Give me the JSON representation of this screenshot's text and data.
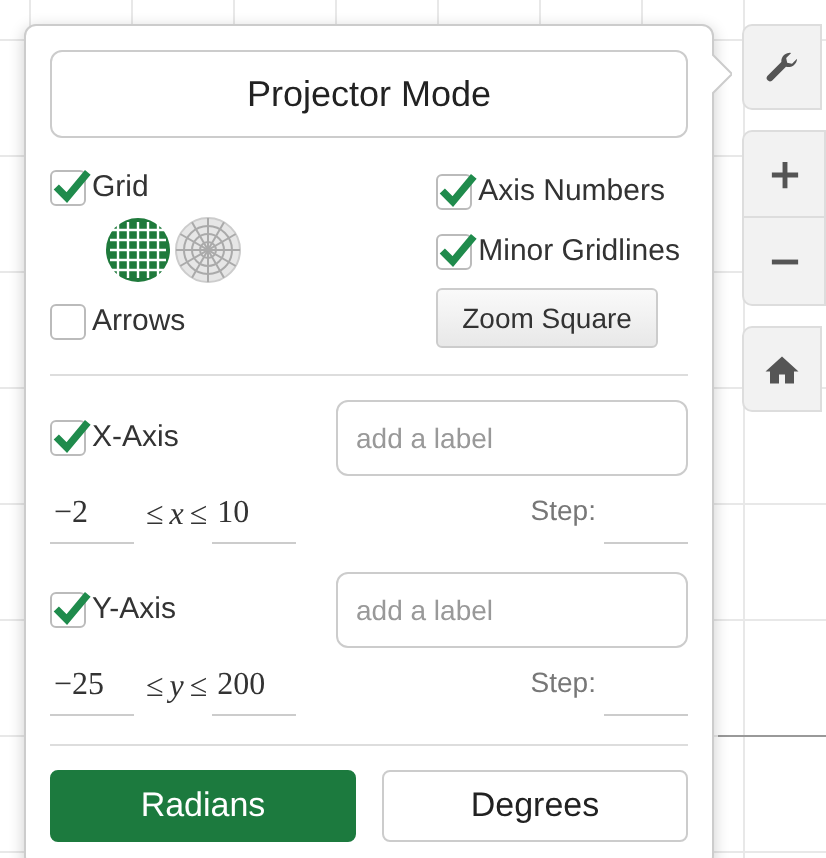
{
  "projector_button": "Projector Mode",
  "grid": {
    "label": "Grid",
    "checked": true
  },
  "grid_types": [
    {
      "kind": "cartesian",
      "selected": true
    },
    {
      "kind": "polar",
      "selected": false
    }
  ],
  "arrows": {
    "label": "Arrows",
    "checked": false
  },
  "axis_numbers": {
    "label": "Axis Numbers",
    "checked": true
  },
  "minor_gridlines": {
    "label": "Minor Gridlines",
    "checked": true
  },
  "zoom_square_button": "Zoom Square",
  "axes": [
    {
      "label": "X-Axis",
      "checked": true,
      "placeholder": "add a label",
      "min": "−2",
      "le": "≤",
      "variable": "x",
      "max": "10",
      "step_label": "Step:"
    },
    {
      "label": "Y-Axis",
      "checked": true,
      "placeholder": "add a label",
      "min": "−25",
      "le": "≤",
      "variable": "y",
      "max": "200",
      "step_label": "Step:"
    }
  ],
  "angle_modes": [
    {
      "label": "Radians",
      "selected": true
    },
    {
      "label": "Degrees",
      "selected": false
    }
  ],
  "toolbar": [
    {
      "kind": "settings"
    },
    {
      "kind": "zoom-in"
    },
    {
      "kind": "zoom-out"
    },
    {
      "kind": "home"
    }
  ]
}
